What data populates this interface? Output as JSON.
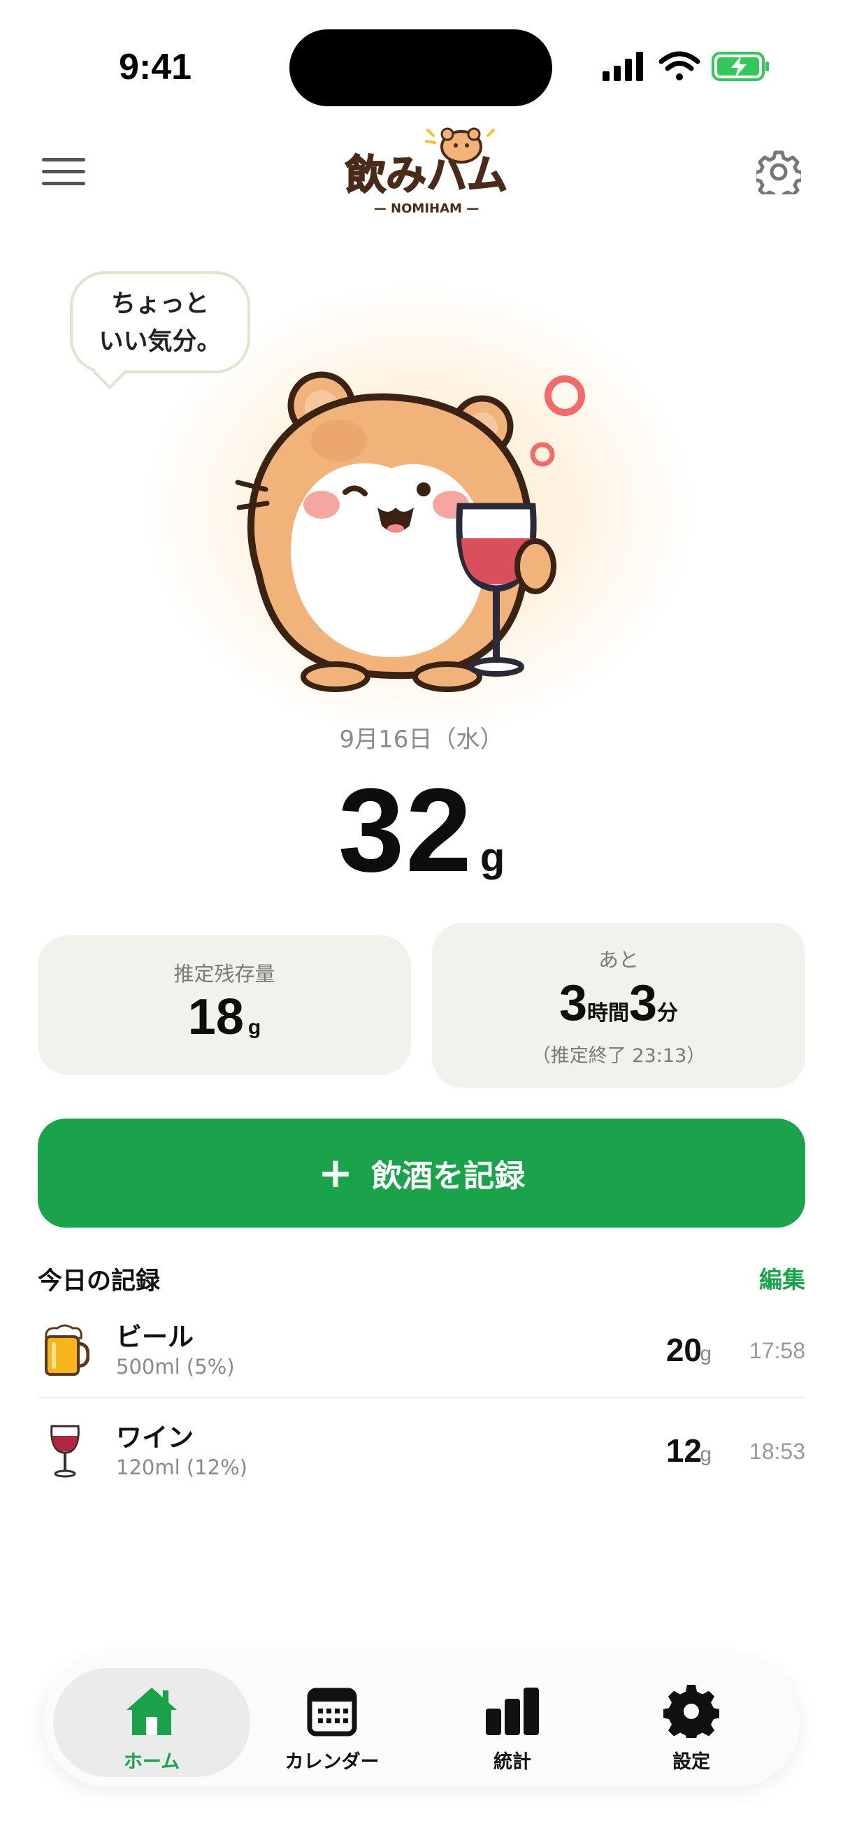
{
  "status_bar": {
    "time": "9:41"
  },
  "header": {
    "logo_text": "飲みハム",
    "logo_subtext": "— NOMIHAM —"
  },
  "hero": {
    "speech_line1": "ちょっと",
    "speech_line2": "いい気分。",
    "date": "9月16日（水）",
    "total_value": "32",
    "total_unit": "g"
  },
  "stats": {
    "remaining": {
      "label": "推定残存量",
      "value": "18",
      "unit": "g"
    },
    "time_left": {
      "label": "あと",
      "hours": "3",
      "hours_unit": "時間",
      "minutes": "3",
      "minutes_unit": "分",
      "end_note": "（推定終了 23:13）"
    }
  },
  "cta": {
    "plus": "+",
    "label": "飲酒を記録"
  },
  "today": {
    "title": "今日の記録",
    "edit_label": "編集",
    "items": [
      {
        "name": "ビール",
        "detail": "500ml (5%)",
        "grams": "20",
        "unit": "g",
        "time": "17:58",
        "icon": "beer-mug-icon"
      },
      {
        "name": "ワイン",
        "detail": "120ml (12%)",
        "grams": "12",
        "unit": "g",
        "time": "18:53",
        "icon": "wine-glass-icon"
      }
    ]
  },
  "tabbar": {
    "active": "home",
    "tabs": [
      {
        "id": "home",
        "label": "ホーム",
        "icon": "home-icon"
      },
      {
        "id": "calendar",
        "label": "カレンダー",
        "icon": "calendar-icon"
      },
      {
        "id": "stats",
        "label": "統計",
        "icon": "bar-chart-icon"
      },
      {
        "id": "settings",
        "label": "設定",
        "icon": "gear-icon"
      }
    ]
  },
  "colors": {
    "accent": "#1aa34a",
    "card_bg": "#f3f1ec",
    "battery": "#34c759"
  }
}
